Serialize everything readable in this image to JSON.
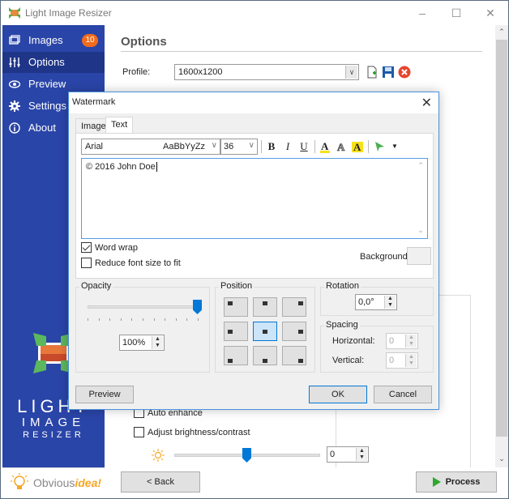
{
  "window": {
    "title": "Light Image Resizer",
    "controls": [
      "minimize",
      "maximize",
      "close"
    ]
  },
  "sidebar": {
    "items": [
      {
        "label": "Images",
        "icon": "images-icon",
        "badge": "10",
        "active": false
      },
      {
        "label": "Options",
        "icon": "sliders-icon",
        "active": true
      },
      {
        "label": "Preview",
        "icon": "eye-icon",
        "active": false
      },
      {
        "label": "Settings",
        "icon": "gear-icon",
        "active": false
      },
      {
        "label": "About",
        "icon": "info-icon",
        "active": false
      }
    ],
    "logo_lines": [
      "LIGHT",
      "IMAGE",
      "RESIZER"
    ],
    "footer_brand": {
      "part1": "Obvious",
      "part2": "idea!"
    }
  },
  "main": {
    "title": "Options",
    "profile_label": "Profile:",
    "profile_value": "1600x1200",
    "auto_enhance_label": "Auto enhance",
    "auto_enhance_checked": false,
    "adjust_label": "Adjust brightness/contrast",
    "adjust_checked": false,
    "brightness_value": "0",
    "brightness_fraction": 0.5
  },
  "bottom": {
    "back_label": "< Back",
    "process_label": "Process"
  },
  "dialog": {
    "title": "Watermark",
    "tabs": [
      {
        "label": "Image",
        "active": false
      },
      {
        "label": "Text",
        "active": true
      }
    ],
    "font_name": "Arial",
    "font_sample": "AaBbYyZz",
    "font_size": "36",
    "format_buttons": {
      "bold": "B",
      "italic": "I",
      "underline": "U"
    },
    "text_value": "© 2016 John Doe",
    "word_wrap_label": "Word wrap",
    "word_wrap_checked": true,
    "reduce_font_label": "Reduce font size to fit",
    "reduce_font_checked": false,
    "background_label": "Background:",
    "opacity": {
      "label": "Opacity",
      "value": "100%",
      "fraction": 1.0
    },
    "position": {
      "label": "Position",
      "selected": "middle-center"
    },
    "rotation": {
      "label": "Rotation",
      "value": "0,0°"
    },
    "spacing": {
      "label": "Spacing",
      "horizontal_label": "Horizontal:",
      "horizontal_value": "0",
      "vertical_label": "Vertical:",
      "vertical_value": "0"
    },
    "preview_label": "Preview",
    "ok_label": "OK",
    "cancel_label": "Cancel"
  },
  "colors": {
    "sidebar": "#2a45a8",
    "sidebar_active": "#1f3588",
    "badge": "#f26b1d",
    "accent": "#0078d7",
    "process_green": "#2ea82e"
  }
}
